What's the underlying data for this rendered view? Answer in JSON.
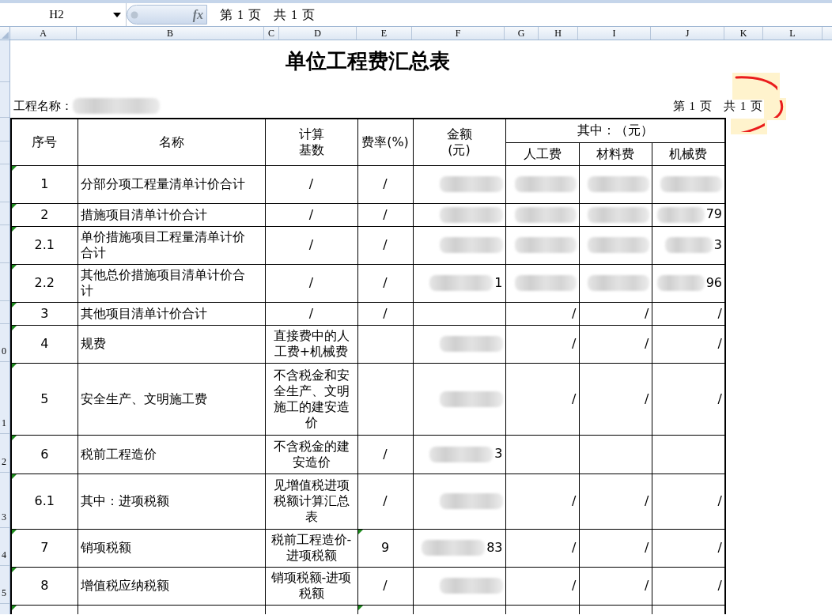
{
  "formula_bar": {
    "cell_ref": "H2",
    "function_label": "fx",
    "content": "第 1 页   共 1 页"
  },
  "column_headers": [
    "A",
    "B",
    "C",
    "D",
    "E",
    "F",
    "G",
    "H",
    "I",
    "J",
    "K",
    "L"
  ],
  "sheet": {
    "title": "单位工程费汇总表",
    "project_label": "工程名称：",
    "project_redacted": true,
    "page_info": "第 1 页   共 1 页"
  },
  "header": {
    "seq": "序号",
    "name": "名称",
    "base": "计算基数",
    "rate": "费率(%)",
    "amount": "金额(元)",
    "of_which": "其中：（元）",
    "labor": "人工费",
    "material": "材料费",
    "machine": "机械费"
  },
  "rows": [
    {
      "seq": "1",
      "name": "分部分项工程量清单计价合计",
      "base": "/",
      "rate": "/",
      "amount": {
        "redacted": true
      },
      "labor": {
        "redacted": true
      },
      "material": {
        "redacted": true
      },
      "machine": {
        "redacted": true
      },
      "seq_flag": true,
      "rate_flag": false
    },
    {
      "seq": "2",
      "name": "措施项目清单计价合计",
      "base": "/",
      "rate": "/",
      "amount": {
        "redacted": true
      },
      "labor": {
        "redacted": true
      },
      "material": {
        "redacted": true
      },
      "machine": {
        "text": "79",
        "redacted": true
      },
      "seq_flag": true,
      "rate_flag": false
    },
    {
      "seq": "2.1",
      "name": "单价措施项目工程量清单计价合计",
      "base": "/",
      "rate": "/",
      "amount": {
        "redacted": true
      },
      "labor": {
        "redacted": true
      },
      "material": {
        "redacted": true
      },
      "machine": {
        "text": "3",
        "redacted": true
      },
      "seq_flag": true,
      "rate_flag": false
    },
    {
      "seq": "2.2",
      "name": "其他总价措施项目清单计价合计",
      "base": "/",
      "rate": "/",
      "amount": {
        "text": "1",
        "redacted": true
      },
      "labor": {
        "redacted": true
      },
      "material": {
        "redacted": true
      },
      "machine": {
        "text": "96",
        "redacted": true
      },
      "seq_flag": true,
      "rate_flag": false
    },
    {
      "seq": "3",
      "name": "其他项目清单计价合计",
      "base": "/",
      "rate": "/",
      "amount": {
        "redacted": false
      },
      "labor": {
        "text": "/",
        "redacted": false
      },
      "material": {
        "text": "/",
        "redacted": false
      },
      "machine": {
        "text": "/",
        "redacted": false
      },
      "seq_flag": true,
      "rate_flag": false
    },
    {
      "row_header": "0",
      "seq": "4",
      "name": "规费",
      "base": "直接费中的人工费+机械费",
      "amount": {
        "redacted": true
      },
      "labor": {
        "text": "/",
        "redacted": false
      },
      "material": {
        "text": "/",
        "redacted": false
      },
      "machine": {
        "text": "/",
        "redacted": false
      },
      "seq_flag": true,
      "rate_flag": false
    },
    {
      "row_header": "1",
      "seq": "5",
      "name": "安全生产、文明施工费",
      "base": "不含税金和安全生产、文明施工的建安造价",
      "amount": {
        "redacted": true
      },
      "labor": {
        "text": "/",
        "redacted": false
      },
      "material": {
        "text": "/",
        "redacted": false
      },
      "machine": {
        "text": "/",
        "redacted": false
      },
      "seq_flag": true,
      "rate_flag": false
    },
    {
      "row_header": "2",
      "seq": "6",
      "name": "税前工程造价",
      "base": "不含税金的建安造价",
      "rate": "/",
      "amount": {
        "text": "3",
        "redacted": true
      },
      "labor": {
        "redacted": false
      },
      "material": {
        "redacted": false
      },
      "machine": {
        "redacted": false
      },
      "seq_flag": true,
      "rate_flag": false
    },
    {
      "row_header": "3",
      "seq": "6.1",
      "name": "其中：进项税额",
      "base": "见增值税进项税额计算汇总表",
      "rate": "/",
      "amount": {
        "redacted": true
      },
      "labor": {
        "text": "/",
        "redacted": false
      },
      "material": {
        "text": "/",
        "redacted": false
      },
      "machine": {
        "text": "/",
        "redacted": false
      },
      "seq_flag": true,
      "rate_flag": false
    },
    {
      "row_header": "4",
      "seq": "7",
      "name": "销项税额",
      "base": "税前工程造价-进项税额",
      "rate": "9",
      "amount": {
        "text": "83",
        "redacted": true
      },
      "labor": {
        "text": "/",
        "redacted": false
      },
      "material": {
        "text": "/",
        "redacted": false
      },
      "machine": {
        "text": "/",
        "redacted": false
      },
      "seq_flag": true,
      "rate_flag": true
    },
    {
      "row_header": "5",
      "seq": "8",
      "name": "增值税应纳税额",
      "base": "销项税额-进项税额",
      "rate": "/",
      "amount": {
        "redacted": true
      },
      "labor": {
        "text": "/",
        "redacted": false
      },
      "material": {
        "text": "/",
        "redacted": false
      },
      "machine": {
        "text": "/",
        "redacted": false
      },
      "seq_flag": true,
      "rate_flag": false
    },
    {
      "amount": {
        "redacted": false
      },
      "labor": {
        "redacted": false
      },
      "material": {
        "redacted": false
      },
      "machine": {
        "redacted": false
      },
      "seq_flag": true,
      "rate_flag": true
    }
  ]
}
